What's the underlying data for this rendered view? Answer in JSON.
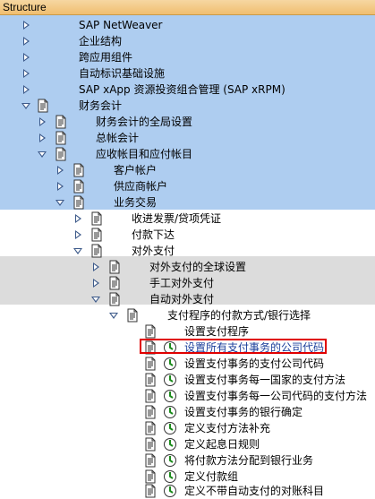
{
  "header": {
    "title": "Structure"
  },
  "tree": [
    {
      "label": "SAP NetWeaver",
      "state": "collapsed",
      "icon": false,
      "exec": false,
      "link": false
    },
    {
      "label": "企业结构",
      "state": "collapsed",
      "icon": false,
      "exec": false,
      "link": false
    },
    {
      "label": "跨应用组件",
      "state": "collapsed",
      "icon": false,
      "exec": false,
      "link": false
    },
    {
      "label": "自动标识基础设施",
      "state": "collapsed",
      "icon": false,
      "exec": false,
      "link": false
    },
    {
      "label": "SAP xApp 资源投资组合管理 (SAP xRPM)",
      "state": "collapsed",
      "icon": false,
      "exec": false,
      "link": false
    },
    {
      "label": "财务会计",
      "state": "expanded",
      "icon": true,
      "exec": false,
      "link": false
    },
    {
      "label": "财务会计的全局设置",
      "state": "collapsed",
      "icon": true,
      "exec": false,
      "link": false
    },
    {
      "label": "总帐会计",
      "state": "collapsed",
      "icon": true,
      "exec": false,
      "link": false
    },
    {
      "label": "应收帐目和应付帐目",
      "state": "expanded",
      "icon": true,
      "exec": false,
      "link": false
    },
    {
      "label": "客户帐户",
      "state": "collapsed",
      "icon": true,
      "exec": false,
      "link": false
    },
    {
      "label": "供应商帐户",
      "state": "collapsed",
      "icon": true,
      "exec": false,
      "link": false
    },
    {
      "label": "业务交易",
      "state": "expanded",
      "icon": true,
      "exec": false,
      "link": false
    },
    {
      "label": "收进发票/贷项凭证",
      "state": "collapsed",
      "icon": true,
      "exec": false,
      "link": false
    },
    {
      "label": "付款下达",
      "state": "collapsed",
      "icon": true,
      "exec": false,
      "link": false
    },
    {
      "label": "对外支付",
      "state": "expanded",
      "icon": true,
      "exec": false,
      "link": false
    },
    {
      "label": "对外支付的全球设置",
      "state": "collapsed",
      "icon": true,
      "exec": false,
      "link": false
    },
    {
      "label": "手工对外支付",
      "state": "collapsed",
      "icon": true,
      "exec": false,
      "link": false
    },
    {
      "label": "自动对外支付",
      "state": "expanded",
      "icon": true,
      "exec": false,
      "link": false
    },
    {
      "label": "支付程序的付款方式/银行选择",
      "state": "expanded",
      "icon": true,
      "exec": false,
      "link": false
    },
    {
      "label": "设置支付程序",
      "state": "leaf",
      "icon": true,
      "exec": false,
      "link": false
    },
    {
      "label": "设置所有支付事务的公司代码",
      "state": "leaf",
      "icon": true,
      "exec": true,
      "link": true
    },
    {
      "label": "设置支付事务的支付公司代码",
      "state": "leaf",
      "icon": true,
      "exec": true,
      "link": false
    },
    {
      "label": "设置支付事务每一国家的支付方法",
      "state": "leaf",
      "icon": true,
      "exec": true,
      "link": false
    },
    {
      "label": "设置支付事务每一公司代码的支付方法",
      "state": "leaf",
      "icon": true,
      "exec": true,
      "link": false
    },
    {
      "label": "设置支付事务的银行确定",
      "state": "leaf",
      "icon": true,
      "exec": true,
      "link": false
    },
    {
      "label": "定义支付方法补充",
      "state": "leaf",
      "icon": true,
      "exec": true,
      "link": false
    },
    {
      "label": "定义起息日规则",
      "state": "leaf",
      "icon": true,
      "exec": true,
      "link": false
    },
    {
      "label": "将付款方法分配到银行业务",
      "state": "leaf",
      "icon": true,
      "exec": true,
      "link": false
    },
    {
      "label": "定义付款组",
      "state": "leaf",
      "icon": true,
      "exec": true,
      "link": false
    },
    {
      "label": "定义不带自动支付的对账科目",
      "state": "leaf",
      "icon": true,
      "exec": true,
      "link": false
    }
  ]
}
